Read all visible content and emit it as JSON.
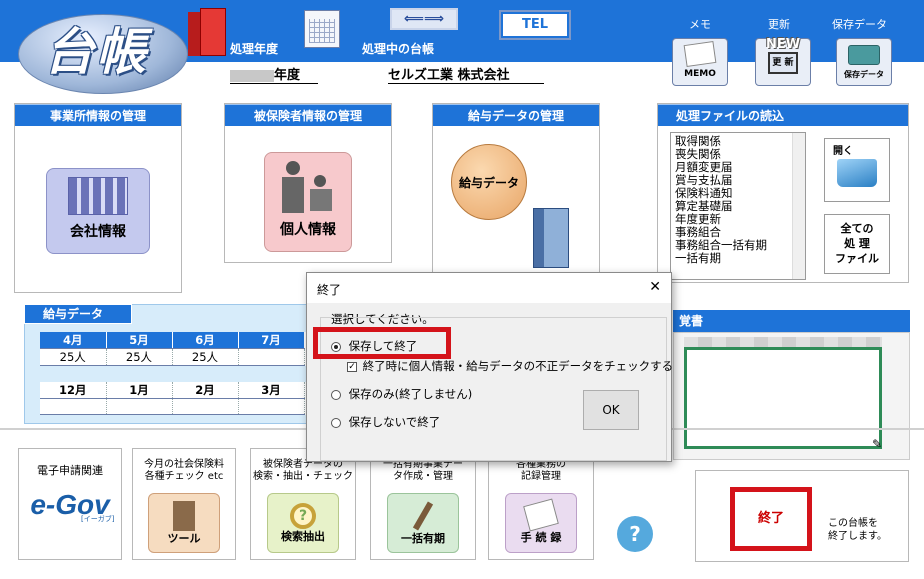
{
  "header": {
    "logo": "台帳",
    "shori_nendo": "処理年度",
    "shori_daicho": "処理中の台帳",
    "nendo_suffix": "年度",
    "company": "セルズ工業 株式会社",
    "tel": "TEL",
    "arrow": "⟸⟹",
    "memo_label": "メモ",
    "memo_btn": "MEMO",
    "koushin_label": "更新",
    "koushin_new": "NEW",
    "koushin_btn": "更 新",
    "hozon_label": "保存データ",
    "hozon_btn": "保存データ"
  },
  "panels": {
    "jigyosho": {
      "title": "事業所情報の管理",
      "button": "会社情報"
    },
    "hihokensha": {
      "title": "被保険者情報の管理",
      "button": "個人情報"
    },
    "kyuyo": {
      "title": "給与データの管理",
      "button": "給与データ"
    },
    "files": {
      "title": "処理ファイルの読込",
      "items": [
        "取得関係",
        "喪失関係",
        "月額変更届",
        "賞与支払届",
        "保険料通知",
        "算定基礎届",
        "年度更新",
        "事務組合",
        "事務組合一括有期",
        "一括有期"
      ],
      "open": "開く",
      "all_files": [
        "全ての",
        "処 理",
        "ファイル"
      ]
    },
    "oboegaki": {
      "title": "覚書"
    }
  },
  "kyuyo_data": {
    "title": "給与データ",
    "row1_months": [
      "4月",
      "5月",
      "6月",
      "7月"
    ],
    "row1_values": [
      "25人",
      "25人",
      "25人",
      ""
    ],
    "row2_months": [
      "12月",
      "1月",
      "2月",
      "3月"
    ],
    "row2_values": [
      "",
      "",
      "",
      ""
    ]
  },
  "bottom": {
    "egov_label": "電子申請関連",
    "egov_logo": "e-Gov",
    "egov_sub": "[イーガブ]",
    "tool_label": [
      "今月の社会保険料",
      "各種チェック etc"
    ],
    "tool_btn": "ツール",
    "kensaku_label": [
      "被保険者データの",
      "検索・抽出・チェック"
    ],
    "kensaku_btn": "検索抽出",
    "ikkatsu_label": [
      "一括有期事業デー",
      "タ作成・管理"
    ],
    "ikkatsu_btn": "一括有期",
    "tetsuzuki_label": [
      "各種業務の",
      "記録管理"
    ],
    "tetsuzuki_btn": "手 続 録",
    "help": "?",
    "exit_btn": "終了",
    "exit_desc": [
      "この台帳を",
      "終了します。"
    ]
  },
  "dialog": {
    "title": "終了",
    "close": "✕",
    "prompt": "選択してください。",
    "option1": "保存して終了",
    "option1_checked": true,
    "checkbox_label": "終了時に個人情報・給与データの不正データをチェックする",
    "checkbox_checked": true,
    "option2": "保存のみ(終了しません)",
    "option3": "保存しないで終了",
    "ok": "OK"
  }
}
